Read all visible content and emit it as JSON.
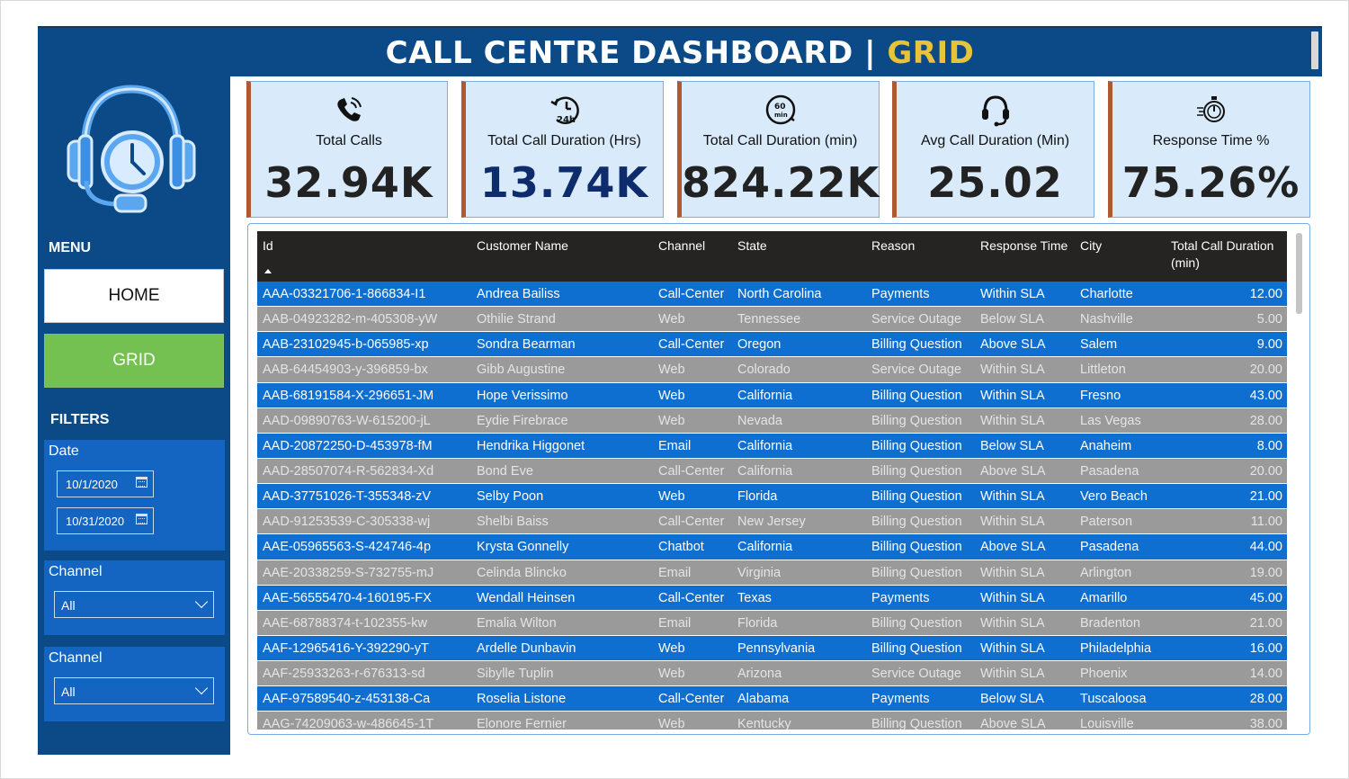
{
  "header": {
    "title_main": "CALL CENTRE DASHBOARD | ",
    "title_accent": "GRID"
  },
  "sidebar": {
    "menu_title": "MENU",
    "nav": {
      "home": "HOME",
      "grid": "GRID"
    },
    "filters_title": "FILTERS",
    "date": {
      "label": "Date",
      "start": "10/1/2020",
      "end": "10/31/2020"
    },
    "channel1": {
      "label": "Channel",
      "value": "All"
    },
    "channel2": {
      "label": "Channel",
      "value": "All"
    }
  },
  "kpis": [
    {
      "label": "Total Calls",
      "value": "32.94K",
      "icon": "phone-ringing-icon"
    },
    {
      "label": "Total Call Duration (Hrs)",
      "value": "13.74K",
      "icon": "24h-clock-icon"
    },
    {
      "label": "Total Call Duration (min)",
      "value": "824.22K",
      "icon": "60-min-timer-icon"
    },
    {
      "label": "Avg Call Duration (Min)",
      "value": "25.02",
      "icon": "headset-icon"
    },
    {
      "label": "Response Time %",
      "value": "75.26%",
      "icon": "stopwatch-fast-icon"
    }
  ],
  "table": {
    "columns": [
      "Id",
      "Customer Name",
      "Channel",
      "State",
      "Reason",
      "Response Time",
      "City",
      "Total Call Duration (min)"
    ],
    "rows": [
      [
        "AAA-03321706-1-866834-I1",
        "Andrea Bailiss",
        "Call-Center",
        "North Carolina",
        "Payments",
        "Within SLA",
        "Charlotte",
        "12.00"
      ],
      [
        "AAB-04923282-m-405308-yW",
        "Othilie Strand",
        "Web",
        "Tennessee",
        "Service Outage",
        "Below SLA",
        "Nashville",
        "5.00"
      ],
      [
        "AAB-23102945-b-065985-xp",
        "Sondra Bearman",
        "Call-Center",
        "Oregon",
        "Billing Question",
        "Above SLA",
        "Salem",
        "9.00"
      ],
      [
        "AAB-64454903-y-396859-bx",
        "Gibb Augustine",
        "Web",
        "Colorado",
        "Service Outage",
        "Within SLA",
        "Littleton",
        "20.00"
      ],
      [
        "AAB-68191584-X-296651-JM",
        "Hope Verissimo",
        "Web",
        "California",
        "Billing Question",
        "Within SLA",
        "Fresno",
        "43.00"
      ],
      [
        "AAD-09890763-W-615200-jL",
        "Eydie Firebrace",
        "Web",
        "Nevada",
        "Billing Question",
        "Within SLA",
        "Las Vegas",
        "28.00"
      ],
      [
        "AAD-20872250-D-453978-fM",
        "Hendrika Higgonet",
        "Email",
        "California",
        "Billing Question",
        "Below SLA",
        "Anaheim",
        "8.00"
      ],
      [
        "AAD-28507074-R-562834-Xd",
        "Bond Eve",
        "Call-Center",
        "California",
        "Billing Question",
        "Above SLA",
        "Pasadena",
        "20.00"
      ],
      [
        "AAD-37751026-T-355348-zV",
        "Selby Poon",
        "Web",
        "Florida",
        "Billing Question",
        "Within SLA",
        "Vero Beach",
        "21.00"
      ],
      [
        "AAD-91253539-C-305338-wj",
        "Shelbi Baiss",
        "Call-Center",
        "New Jersey",
        "Billing Question",
        "Within SLA",
        "Paterson",
        "11.00"
      ],
      [
        "AAE-05965563-S-424746-4p",
        "Krysta Gonnelly",
        "Chatbot",
        "California",
        "Billing Question",
        "Above SLA",
        "Pasadena",
        "44.00"
      ],
      [
        "AAE-20338259-S-732755-mJ",
        "Celinda Blincko",
        "Email",
        "Virginia",
        "Billing Question",
        "Within SLA",
        "Arlington",
        "19.00"
      ],
      [
        "AAE-56555470-4-160195-FX",
        "Wendall Heinsen",
        "Call-Center",
        "Texas",
        "Payments",
        "Within SLA",
        "Amarillo",
        "45.00"
      ],
      [
        "AAE-68788374-t-102355-kw",
        "Emalia Wilton",
        "Email",
        "Florida",
        "Billing Question",
        "Within SLA",
        "Bradenton",
        "21.00"
      ],
      [
        "AAF-12965416-Y-392290-yT",
        "Ardelle Dunbavin",
        "Web",
        "Pennsylvania",
        "Billing Question",
        "Within SLA",
        "Philadelphia",
        "16.00"
      ],
      [
        "AAF-25933263-r-676313-sd",
        "Sibylle Tuplin",
        "Web",
        "Arizona",
        "Service Outage",
        "Within SLA",
        "Phoenix",
        "14.00"
      ],
      [
        "AAF-97589540-z-453138-Ca",
        "Roselia Listone",
        "Call-Center",
        "Alabama",
        "Payments",
        "Below SLA",
        "Tuscaloosa",
        "28.00"
      ],
      [
        "AAG-74209063-w-486645-1T",
        "Elonore Fernier",
        "Web",
        "Kentucky",
        "Billing Question",
        "Above SLA",
        "Louisville",
        "38.00"
      ]
    ]
  },
  "colors": {
    "navy": "#0b4a86",
    "accent_yellow": "#e7c33a",
    "row_blue": "#0f6fd1",
    "row_gray": "#9a9a9a",
    "card_bg": "#d9ebfb",
    "card_border_left": "#b0582f",
    "grid_green": "#74c050"
  }
}
